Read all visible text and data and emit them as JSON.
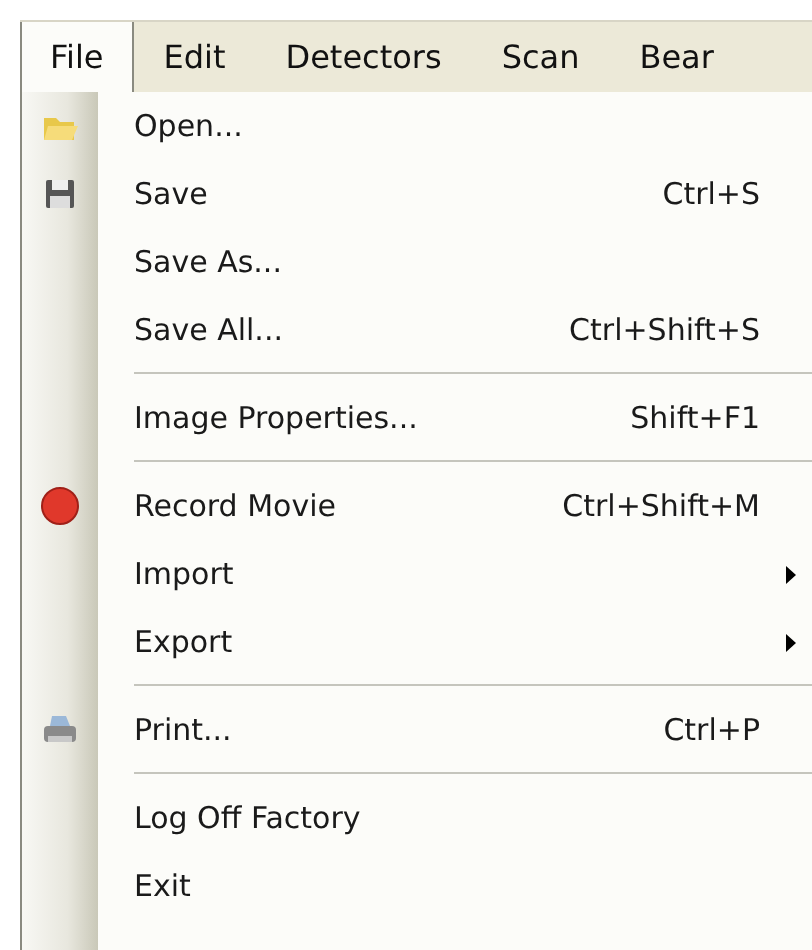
{
  "menubar": [
    {
      "label": "File",
      "selected": true
    },
    {
      "label": "Edit",
      "selected": false
    },
    {
      "label": "Detectors",
      "selected": false
    },
    {
      "label": "Scan",
      "selected": false
    },
    {
      "label": "Bear",
      "selected": false
    }
  ],
  "menu": [
    {
      "kind": "item",
      "label": "Open..."
    },
    {
      "kind": "item",
      "label": "Save",
      "shortcut": "Ctrl+S"
    },
    {
      "kind": "item",
      "label": "Save As..."
    },
    {
      "kind": "item",
      "label": "Save All...",
      "shortcut": "Ctrl+Shift+S"
    },
    {
      "kind": "separator"
    },
    {
      "kind": "item",
      "label": "Image Properties...",
      "shortcut": "Shift+F1"
    },
    {
      "kind": "separator"
    },
    {
      "kind": "item",
      "label": "Record Movie",
      "shortcut": "Ctrl+Shift+M"
    },
    {
      "kind": "item",
      "label": "Import",
      "submenu": true
    },
    {
      "kind": "item",
      "label": "Export",
      "submenu": true
    },
    {
      "kind": "separator"
    },
    {
      "kind": "item",
      "label": "Print...",
      "shortcut": "Ctrl+P"
    },
    {
      "kind": "separator"
    },
    {
      "kind": "item",
      "label": "Log Off Factory"
    },
    {
      "kind": "item",
      "label": "Exit"
    }
  ]
}
